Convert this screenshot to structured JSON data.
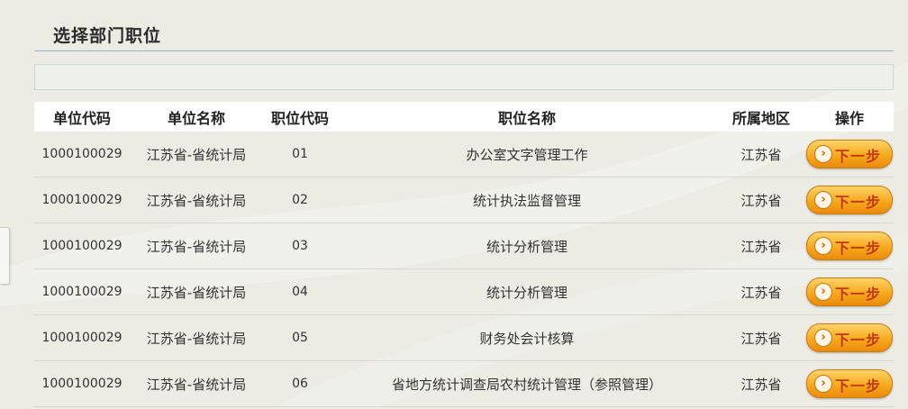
{
  "panel": {
    "title": "选择部门职位"
  },
  "table": {
    "headers": {
      "unit_code": "单位代码",
      "unit_name": "单位名称",
      "job_code": "职位代码",
      "job_name": "职位名称",
      "region": "所属地区",
      "action": "操作"
    },
    "action_label": "下一步",
    "action_icon": "arrow-right-icon",
    "rows": [
      {
        "unit_code": "1000100029",
        "unit_name": "江苏省-省统计局",
        "job_code": "01",
        "job_name": "办公室文字管理工作",
        "region": "江苏省"
      },
      {
        "unit_code": "1000100029",
        "unit_name": "江苏省-省统计局",
        "job_code": "02",
        "job_name": "统计执法监督管理",
        "region": "江苏省"
      },
      {
        "unit_code": "1000100029",
        "unit_name": "江苏省-省统计局",
        "job_code": "03",
        "job_name": "统计分析管理",
        "region": "江苏省"
      },
      {
        "unit_code": "1000100029",
        "unit_name": "江苏省-省统计局",
        "job_code": "04",
        "job_name": "统计分析管理",
        "region": "江苏省"
      },
      {
        "unit_code": "1000100029",
        "unit_name": "江苏省-省统计局",
        "job_code": "05",
        "job_name": "财务处会计核算",
        "region": "江苏省"
      },
      {
        "unit_code": "1000100029",
        "unit_name": "江苏省-省统计局",
        "job_code": "06",
        "job_name": "省地方统计调查局农村统计管理（参照管理）",
        "region": "江苏省"
      }
    ]
  },
  "colors": {
    "background": "#ecebe4",
    "header_bg": "#ffffff",
    "button_orange": "#f7a91c",
    "button_text": "#c23a10"
  }
}
